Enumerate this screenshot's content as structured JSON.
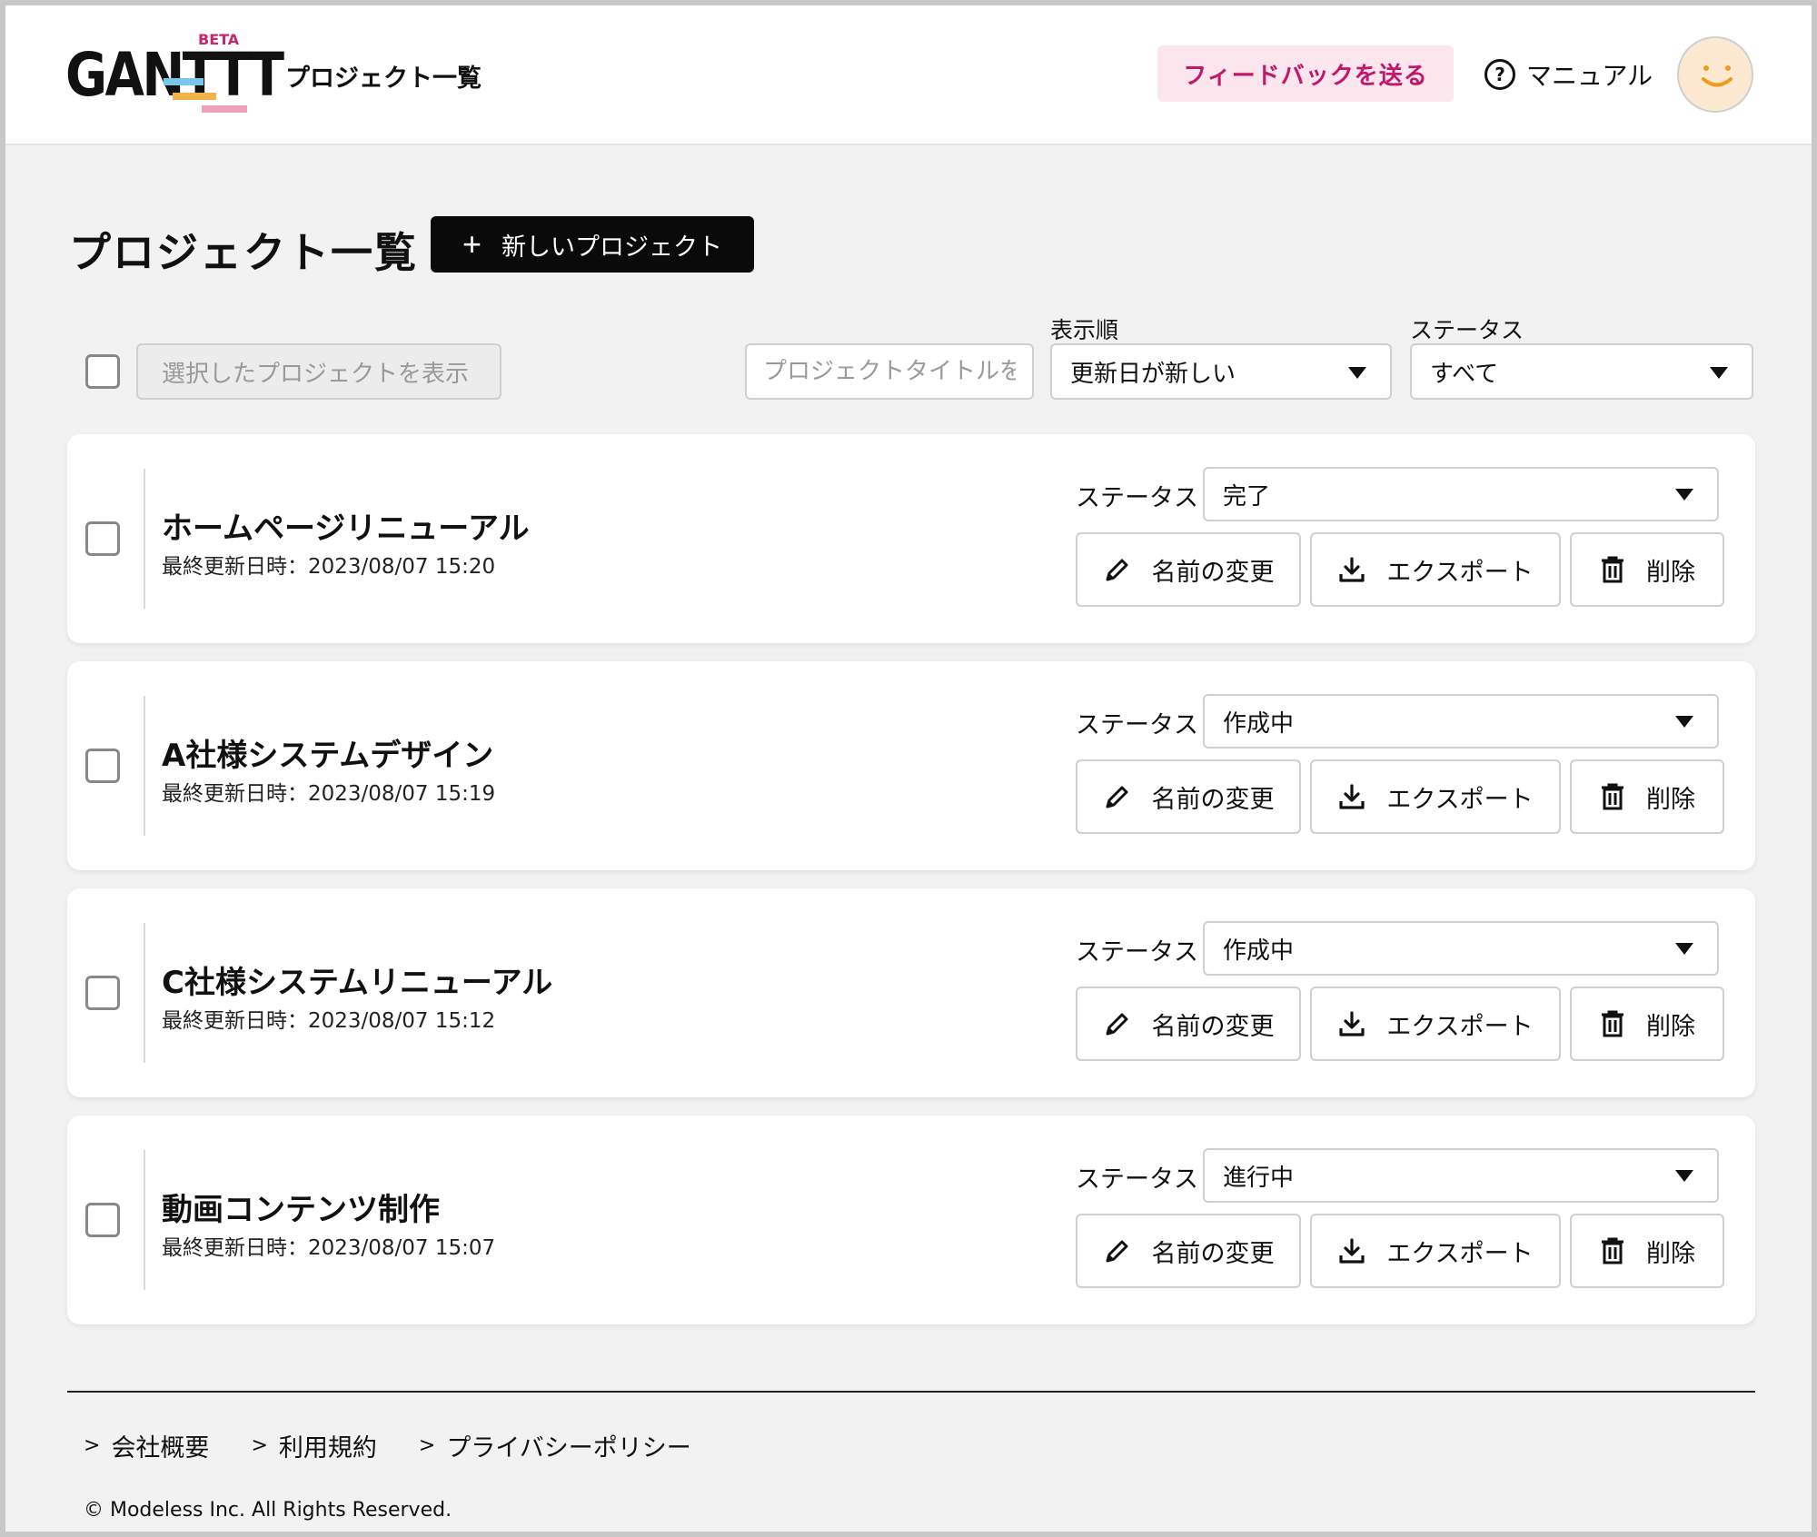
{
  "header": {
    "logo_text": "GANTTT",
    "logo_badge": "BETA",
    "title": "プロジェクト一覧",
    "feedback_label": "フィードバックを送る",
    "manual_label": "マニュアル",
    "help_icon_glyph": "?"
  },
  "page": {
    "title": "プロジェクト一覧",
    "new_project_plus": "+",
    "new_project_label": "新しいプロジェクト"
  },
  "filters": {
    "show_selected_label": "選択したプロジェクトを表示",
    "search_placeholder": "プロジェクトタイトルを",
    "sort_label": "表示順",
    "sort_value": "更新日が新しい",
    "status_label": "ステータス",
    "status_value": "すべて"
  },
  "projects": [
    {
      "title": "ホームページリニューアル",
      "updated": "最終更新日時：2023/08/07 15:20",
      "status_label": "ステータス",
      "status": "完了",
      "rename_label": "名前の変更",
      "export_label": "エクスポート",
      "delete_label": "削除"
    },
    {
      "title": "A社様システムデザイン",
      "updated": "最終更新日時：2023/08/07 15:19",
      "status_label": "ステータス",
      "status": "作成中",
      "rename_label": "名前の変更",
      "export_label": "エクスポート",
      "delete_label": "削除"
    },
    {
      "title": "C社様システムリニューアル",
      "updated": "最終更新日時：2023/08/07 15:12",
      "status_label": "ステータス",
      "status": "作成中",
      "rename_label": "名前の変更",
      "export_label": "エクスポート",
      "delete_label": "削除"
    },
    {
      "title": "動画コンテンツ制作",
      "updated": "最終更新日時：2023/08/07 15:07",
      "status_label": "ステータス",
      "status": "進行中",
      "rename_label": "名前の変更",
      "export_label": "エクスポート",
      "delete_label": "削除"
    }
  ],
  "footer": {
    "chevron": ">",
    "links": [
      "会社概要",
      "利用規約",
      "プライバシーポリシー"
    ],
    "copyright": "© Modeless Inc. All Rights Reserved."
  },
  "colors": {
    "accent": "#c0186a",
    "feedback_bg": "#fbe6ee",
    "primary_button": "#0a0a0a",
    "page_bg": "#f2f2f2"
  },
  "icons": {
    "help": "question-circle-icon",
    "rename": "pencil-icon",
    "export": "download-icon",
    "delete": "trash-icon",
    "dropdown": "triangle-down-icon",
    "avatar": "smiley-icon"
  }
}
